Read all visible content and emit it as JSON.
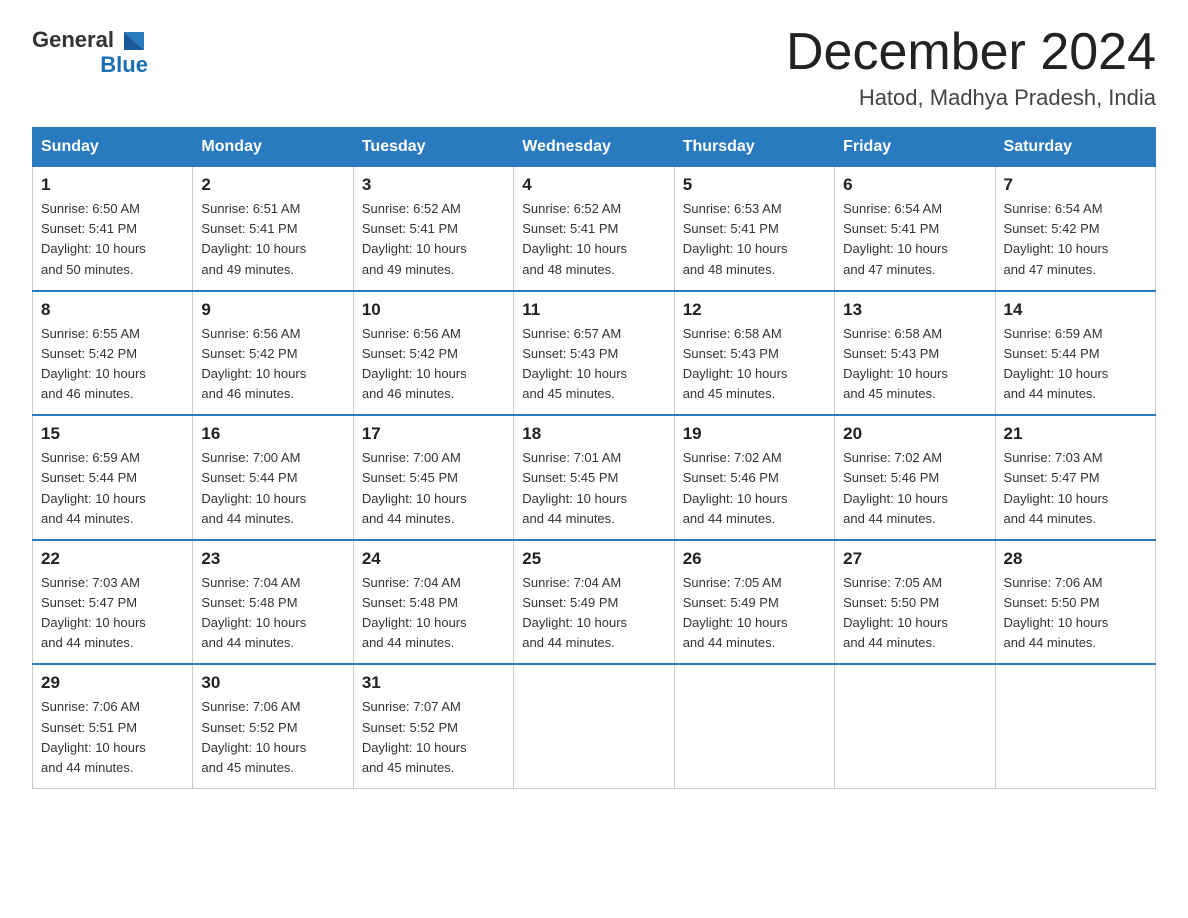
{
  "logo": {
    "text_general": "General",
    "text_blue": "Blue"
  },
  "calendar": {
    "title": "December 2024",
    "subtitle": "Hatod, Madhya Pradesh, India"
  },
  "days_of_week": [
    "Sunday",
    "Monday",
    "Tuesday",
    "Wednesday",
    "Thursday",
    "Friday",
    "Saturday"
  ],
  "weeks": [
    [
      {
        "day": "1",
        "sunrise": "6:50 AM",
        "sunset": "5:41 PM",
        "daylight": "10 hours and 50 minutes."
      },
      {
        "day": "2",
        "sunrise": "6:51 AM",
        "sunset": "5:41 PM",
        "daylight": "10 hours and 49 minutes."
      },
      {
        "day": "3",
        "sunrise": "6:52 AM",
        "sunset": "5:41 PM",
        "daylight": "10 hours and 49 minutes."
      },
      {
        "day": "4",
        "sunrise": "6:52 AM",
        "sunset": "5:41 PM",
        "daylight": "10 hours and 48 minutes."
      },
      {
        "day": "5",
        "sunrise": "6:53 AM",
        "sunset": "5:41 PM",
        "daylight": "10 hours and 48 minutes."
      },
      {
        "day": "6",
        "sunrise": "6:54 AM",
        "sunset": "5:41 PM",
        "daylight": "10 hours and 47 minutes."
      },
      {
        "day": "7",
        "sunrise": "6:54 AM",
        "sunset": "5:42 PM",
        "daylight": "10 hours and 47 minutes."
      }
    ],
    [
      {
        "day": "8",
        "sunrise": "6:55 AM",
        "sunset": "5:42 PM",
        "daylight": "10 hours and 46 minutes."
      },
      {
        "day": "9",
        "sunrise": "6:56 AM",
        "sunset": "5:42 PM",
        "daylight": "10 hours and 46 minutes."
      },
      {
        "day": "10",
        "sunrise": "6:56 AM",
        "sunset": "5:42 PM",
        "daylight": "10 hours and 46 minutes."
      },
      {
        "day": "11",
        "sunrise": "6:57 AM",
        "sunset": "5:43 PM",
        "daylight": "10 hours and 45 minutes."
      },
      {
        "day": "12",
        "sunrise": "6:58 AM",
        "sunset": "5:43 PM",
        "daylight": "10 hours and 45 minutes."
      },
      {
        "day": "13",
        "sunrise": "6:58 AM",
        "sunset": "5:43 PM",
        "daylight": "10 hours and 45 minutes."
      },
      {
        "day": "14",
        "sunrise": "6:59 AM",
        "sunset": "5:44 PM",
        "daylight": "10 hours and 44 minutes."
      }
    ],
    [
      {
        "day": "15",
        "sunrise": "6:59 AM",
        "sunset": "5:44 PM",
        "daylight": "10 hours and 44 minutes."
      },
      {
        "day": "16",
        "sunrise": "7:00 AM",
        "sunset": "5:44 PM",
        "daylight": "10 hours and 44 minutes."
      },
      {
        "day": "17",
        "sunrise": "7:00 AM",
        "sunset": "5:45 PM",
        "daylight": "10 hours and 44 minutes."
      },
      {
        "day": "18",
        "sunrise": "7:01 AM",
        "sunset": "5:45 PM",
        "daylight": "10 hours and 44 minutes."
      },
      {
        "day": "19",
        "sunrise": "7:02 AM",
        "sunset": "5:46 PM",
        "daylight": "10 hours and 44 minutes."
      },
      {
        "day": "20",
        "sunrise": "7:02 AM",
        "sunset": "5:46 PM",
        "daylight": "10 hours and 44 minutes."
      },
      {
        "day": "21",
        "sunrise": "7:03 AM",
        "sunset": "5:47 PM",
        "daylight": "10 hours and 44 minutes."
      }
    ],
    [
      {
        "day": "22",
        "sunrise": "7:03 AM",
        "sunset": "5:47 PM",
        "daylight": "10 hours and 44 minutes."
      },
      {
        "day": "23",
        "sunrise": "7:04 AM",
        "sunset": "5:48 PM",
        "daylight": "10 hours and 44 minutes."
      },
      {
        "day": "24",
        "sunrise": "7:04 AM",
        "sunset": "5:48 PM",
        "daylight": "10 hours and 44 minutes."
      },
      {
        "day": "25",
        "sunrise": "7:04 AM",
        "sunset": "5:49 PM",
        "daylight": "10 hours and 44 minutes."
      },
      {
        "day": "26",
        "sunrise": "7:05 AM",
        "sunset": "5:49 PM",
        "daylight": "10 hours and 44 minutes."
      },
      {
        "day": "27",
        "sunrise": "7:05 AM",
        "sunset": "5:50 PM",
        "daylight": "10 hours and 44 minutes."
      },
      {
        "day": "28",
        "sunrise": "7:06 AM",
        "sunset": "5:50 PM",
        "daylight": "10 hours and 44 minutes."
      }
    ],
    [
      {
        "day": "29",
        "sunrise": "7:06 AM",
        "sunset": "5:51 PM",
        "daylight": "10 hours and 44 minutes."
      },
      {
        "day": "30",
        "sunrise": "7:06 AM",
        "sunset": "5:52 PM",
        "daylight": "10 hours and 45 minutes."
      },
      {
        "day": "31",
        "sunrise": "7:07 AM",
        "sunset": "5:52 PM",
        "daylight": "10 hours and 45 minutes."
      },
      null,
      null,
      null,
      null
    ]
  ],
  "labels": {
    "sunrise": "Sunrise:",
    "sunset": "Sunset:",
    "daylight": "Daylight:"
  }
}
